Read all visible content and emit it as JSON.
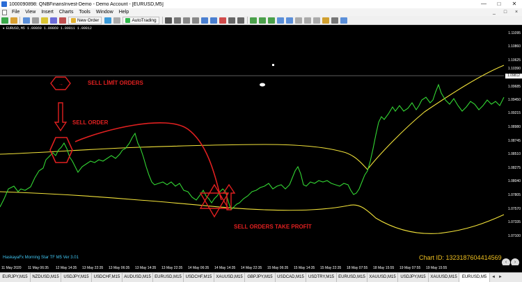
{
  "window": {
    "title": "1000090898: QNBFinansInvest-Demo - Demo Account - [EURUSD,M5]",
    "controls": [
      "—",
      "□",
      "✕"
    ]
  },
  "menubar": {
    "items": [
      "File",
      "View",
      "Insert",
      "Charts",
      "Tools",
      "Window",
      "Help"
    ],
    "mdi_controls": [
      "_",
      "□",
      "×"
    ]
  },
  "toolbar": {
    "new_order_label": "New Order",
    "autotrading_label": "AutoTrading",
    "icons": [
      "new-chart-icon",
      "profiles-icon",
      "market-watch-icon",
      "data-window-icon",
      "navigator-icon",
      "terminal-icon",
      "strategy-tester-icon",
      "cursor-icon",
      "crosshair-icon",
      "vertical-line-icon",
      "horizontal-line-icon",
      "trendline-icon",
      "channel-icon",
      "fibonacci-icon",
      "text-icon",
      "label-icon",
      "bar-chart-icon",
      "candle-chart-icon",
      "line-chart-icon",
      "zoom-in-icon",
      "zoom-out-icon",
      "tile-icon",
      "autoscroll-icon",
      "chart-shift-icon",
      "indicators-icon",
      "periods-icon",
      "templates-icon"
    ]
  },
  "chart": {
    "header": "EURUSD,M5  1.09869 1.09869 1.09811 1.09812",
    "indicator_label": "HaskayaFx Morning Star TF M5 Ver 3.01",
    "chart_id": "Chart ID: 1323187604414569",
    "annotations": {
      "sell_limit": "SELL LİMİT ORDERS",
      "sell_order": "SELL ORDER",
      "take_profit": "SELL ORDERS TAKE PROFİT"
    },
    "price_labels": [
      "1.11095",
      "1.10860",
      "1.10625",
      "1.10390",
      "1.09812",
      "1.09685",
      "1.09450",
      "1.09215",
      "1.08980",
      "1.08745",
      "1.08510",
      "1.08275",
      "1.08040",
      "1.07805",
      "1.07570",
      "1.07335",
      "1.07100"
    ],
    "current_price": "1.09812",
    "time_labels": [
      "11 May 2020",
      "11 May 06:35",
      "12 May 14:35",
      "13 May 22:35",
      "13 May 06:35",
      "13 May 14:35",
      "13 May 22:35",
      "14 May 06:35",
      "14 May 14:35",
      "14 May 22:35",
      "15 May 06:35",
      "15 May 14:35",
      "15 May 22:35",
      "18 May 07:55",
      "18 May 15:55",
      "19 May 07:55",
      "19 May 15:55"
    ]
  },
  "tabs": {
    "items": [
      "EURJPY,M15",
      "NZDUSD,M15",
      "USDJPY,M15",
      "USDCHF,M15",
      "AUDUSD,M15",
      "EURUSD,M15",
      "USDCHF,M15",
      "XAUUSD,M15",
      "GBPJPY,M15",
      "USDCAD,M15",
      "USDTRY,M15",
      "EURUSD,M15",
      "XAUUSD,M15",
      "USDJPY,M15",
      "XAUUSD,M15",
      "EURUSD,M5"
    ],
    "active": "EURUSD,M5"
  },
  "colors": {
    "price_line": "#33d633",
    "band_line": "#f4e43a",
    "annotation": "#e02020",
    "chart_bg": "#000000",
    "indicator_text": "#41c8f5",
    "chart_id_text": "#f0c020"
  }
}
